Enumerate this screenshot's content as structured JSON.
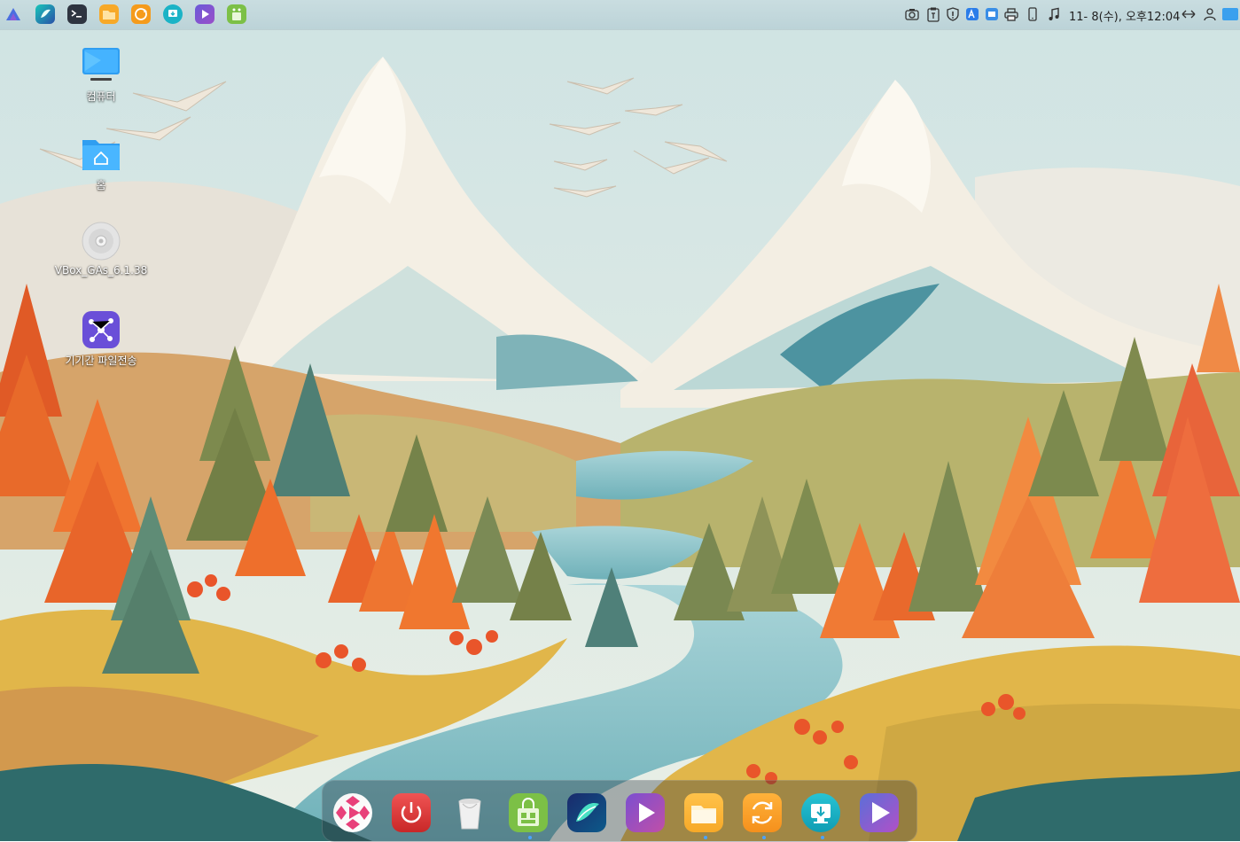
{
  "topbar": {
    "launcher_icon": "launcher-icon",
    "apps": [
      {
        "icon": "browser-icon"
      },
      {
        "icon": "terminal-icon"
      },
      {
        "icon": "file-manager-icon"
      },
      {
        "icon": "sync-icon"
      },
      {
        "icon": "app-store-icon"
      },
      {
        "icon": "video-player-icon"
      },
      {
        "icon": "software-center-icon"
      }
    ],
    "tray": [
      {
        "icon": "camera-icon"
      },
      {
        "icon": "clipboard-icon"
      },
      {
        "icon": "security-shield-icon"
      },
      {
        "icon": "translate-icon"
      },
      {
        "icon": "screenshot-icon"
      },
      {
        "icon": "printer-icon"
      },
      {
        "icon": "phone-icon"
      },
      {
        "icon": "music-note-icon"
      }
    ],
    "clock": "11- 8(수), 오후12:04",
    "tray_right": [
      {
        "icon": "network-icon"
      },
      {
        "icon": "user-icon"
      },
      {
        "icon": "show-desktop-icon"
      }
    ]
  },
  "desktop": {
    "icons": [
      {
        "label": "컴퓨터",
        "icon": "computer-icon"
      },
      {
        "label": "홈",
        "icon": "home-folder-icon"
      },
      {
        "label": "VBox_GAs_6.1.38",
        "icon": "disc-icon"
      },
      {
        "label": "기기간 파일전송",
        "icon": "file-transfer-icon"
      }
    ]
  },
  "dock": {
    "items": [
      {
        "icon": "media-player-icon",
        "color": "#e8407a"
      },
      {
        "icon": "power-icon",
        "color": "#e23b3b"
      },
      {
        "icon": "trash-icon",
        "color": "#e8e8e8"
      },
      {
        "icon": "software-center-icon",
        "color": "#8bc34a"
      },
      {
        "icon": "browser-icon",
        "color": "#1a2a6c"
      },
      {
        "icon": "video-player-icon",
        "color": "#7b4fd0"
      },
      {
        "icon": "file-manager-icon",
        "color": "#f7a928"
      },
      {
        "icon": "sync-icon",
        "color": "#f59b1c"
      },
      {
        "icon": "app-store-icon",
        "color": "#1bb3c6"
      },
      {
        "icon": "screen-recorder-icon",
        "color": "#6b5bd6"
      }
    ]
  }
}
